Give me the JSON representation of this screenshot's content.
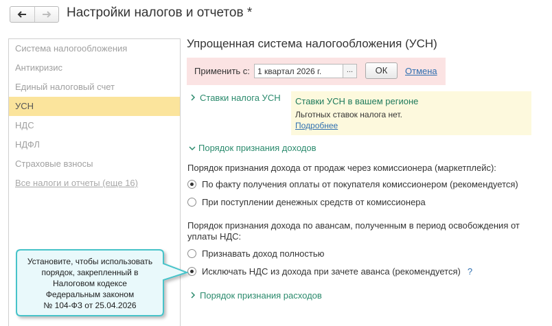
{
  "header": {
    "title": "Настройки налогов и отчетов *",
    "back_icon": "arrow-left-icon",
    "forward_icon": "arrow-right-icon"
  },
  "sidebar": {
    "items": [
      {
        "label": "Система налогообложения",
        "active": false
      },
      {
        "label": "Антикризис",
        "active": false
      },
      {
        "label": "Единый налоговый счет",
        "active": false
      },
      {
        "label": "УСН",
        "active": true
      },
      {
        "label": "НДС",
        "active": false
      },
      {
        "label": "НДФЛ",
        "active": false
      },
      {
        "label": "Страховые взносы",
        "active": false
      },
      {
        "label": "Все налоги и отчеты (еще 16)",
        "active": false,
        "link": true
      }
    ]
  },
  "main": {
    "title": "Упрощенная система налогообложения (УСН)",
    "apply": {
      "label": "Применить с:",
      "value": "1 квартал 2026 г.",
      "picker_label": "...",
      "ok_label": "ОК",
      "cancel_label": "Отмена"
    },
    "rates_group": {
      "label": "Ставки налога УСН",
      "expanded": false,
      "info": {
        "title": "Ставки УСН в вашем регионе",
        "text": "Льготных ставок налога нет.",
        "link": "Подробнее"
      }
    },
    "income_group": {
      "label": "Порядок признания доходов",
      "expanded": true,
      "q1": "Порядок признания дохода от продаж через комиссионера (маркетплейс):",
      "q1_options": [
        {
          "label": "По факту получения оплаты от покупателя комиссионером (рекомендуется)",
          "checked": true
        },
        {
          "label": "При поступлении денежных средств от комиссионера",
          "checked": false
        }
      ],
      "q2_line1": "Порядок признания дохода по авансам, полученным в период освобождения от",
      "q2_line2": "уплаты НДС:",
      "q2_options": [
        {
          "label": "Признавать доход полностью",
          "checked": false
        },
        {
          "label": "Исключать НДС из дохода при зачете аванса (рекомендуется)",
          "checked": true
        }
      ],
      "help_label": "?"
    },
    "expense_group": {
      "label": "Порядок признания расходов",
      "expanded": false
    }
  },
  "callout": {
    "lines": [
      "Установите, чтобы использовать",
      "порядок, закрепленный в",
      "Налоговом кодексе",
      "Федеральным законом",
      "№ 104-ФЗ от 25.04.2026"
    ],
    "fill": "#e9f9fb",
    "border": "#46c3c9"
  },
  "colors": {
    "active_item": "#fbe49c",
    "accent_green": "#2a8a6c",
    "link_blue": "#2e6fb0",
    "apply_bg": "#fbe3e3",
    "info_bg": "#fdf9dd"
  }
}
